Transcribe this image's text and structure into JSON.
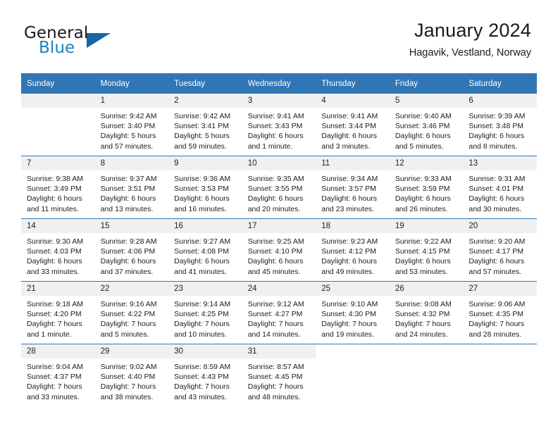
{
  "brand": {
    "word1": "General",
    "word2": "Blue",
    "accent_color": "#1a7fc1",
    "triangle_color": "#1565a8"
  },
  "header": {
    "title": "January 2024",
    "subtitle": "Hagavik, Vestland, Norway"
  },
  "calendar": {
    "header_bg": "#3076b5",
    "daynum_bg": "#f0f0f0",
    "weekday_headers": [
      "Sunday",
      "Monday",
      "Tuesday",
      "Wednesday",
      "Thursday",
      "Friday",
      "Saturday"
    ],
    "weeks": [
      [
        {
          "num": "",
          "lines": []
        },
        {
          "num": "1",
          "lines": [
            "Sunrise: 9:42 AM",
            "Sunset: 3:40 PM",
            "Daylight: 5 hours",
            "and 57 minutes."
          ]
        },
        {
          "num": "2",
          "lines": [
            "Sunrise: 9:42 AM",
            "Sunset: 3:41 PM",
            "Daylight: 5 hours",
            "and 59 minutes."
          ]
        },
        {
          "num": "3",
          "lines": [
            "Sunrise: 9:41 AM",
            "Sunset: 3:43 PM",
            "Daylight: 6 hours",
            "and 1 minute."
          ]
        },
        {
          "num": "4",
          "lines": [
            "Sunrise: 9:41 AM",
            "Sunset: 3:44 PM",
            "Daylight: 6 hours",
            "and 3 minutes."
          ]
        },
        {
          "num": "5",
          "lines": [
            "Sunrise: 9:40 AM",
            "Sunset: 3:46 PM",
            "Daylight: 6 hours",
            "and 5 minutes."
          ]
        },
        {
          "num": "6",
          "lines": [
            "Sunrise: 9:39 AM",
            "Sunset: 3:48 PM",
            "Daylight: 6 hours",
            "and 8 minutes."
          ]
        }
      ],
      [
        {
          "num": "7",
          "lines": [
            "Sunrise: 9:38 AM",
            "Sunset: 3:49 PM",
            "Daylight: 6 hours",
            "and 11 minutes."
          ]
        },
        {
          "num": "8",
          "lines": [
            "Sunrise: 9:37 AM",
            "Sunset: 3:51 PM",
            "Daylight: 6 hours",
            "and 13 minutes."
          ]
        },
        {
          "num": "9",
          "lines": [
            "Sunrise: 9:36 AM",
            "Sunset: 3:53 PM",
            "Daylight: 6 hours",
            "and 16 minutes."
          ]
        },
        {
          "num": "10",
          "lines": [
            "Sunrise: 9:35 AM",
            "Sunset: 3:55 PM",
            "Daylight: 6 hours",
            "and 20 minutes."
          ]
        },
        {
          "num": "11",
          "lines": [
            "Sunrise: 9:34 AM",
            "Sunset: 3:57 PM",
            "Daylight: 6 hours",
            "and 23 minutes."
          ]
        },
        {
          "num": "12",
          "lines": [
            "Sunrise: 9:33 AM",
            "Sunset: 3:59 PM",
            "Daylight: 6 hours",
            "and 26 minutes."
          ]
        },
        {
          "num": "13",
          "lines": [
            "Sunrise: 9:31 AM",
            "Sunset: 4:01 PM",
            "Daylight: 6 hours",
            "and 30 minutes."
          ]
        }
      ],
      [
        {
          "num": "14",
          "lines": [
            "Sunrise: 9:30 AM",
            "Sunset: 4:03 PM",
            "Daylight: 6 hours",
            "and 33 minutes."
          ]
        },
        {
          "num": "15",
          "lines": [
            "Sunrise: 9:28 AM",
            "Sunset: 4:06 PM",
            "Daylight: 6 hours",
            "and 37 minutes."
          ]
        },
        {
          "num": "16",
          "lines": [
            "Sunrise: 9:27 AM",
            "Sunset: 4:08 PM",
            "Daylight: 6 hours",
            "and 41 minutes."
          ]
        },
        {
          "num": "17",
          "lines": [
            "Sunrise: 9:25 AM",
            "Sunset: 4:10 PM",
            "Daylight: 6 hours",
            "and 45 minutes."
          ]
        },
        {
          "num": "18",
          "lines": [
            "Sunrise: 9:23 AM",
            "Sunset: 4:12 PM",
            "Daylight: 6 hours",
            "and 49 minutes."
          ]
        },
        {
          "num": "19",
          "lines": [
            "Sunrise: 9:22 AM",
            "Sunset: 4:15 PM",
            "Daylight: 6 hours",
            "and 53 minutes."
          ]
        },
        {
          "num": "20",
          "lines": [
            "Sunrise: 9:20 AM",
            "Sunset: 4:17 PM",
            "Daylight: 6 hours",
            "and 57 minutes."
          ]
        }
      ],
      [
        {
          "num": "21",
          "lines": [
            "Sunrise: 9:18 AM",
            "Sunset: 4:20 PM",
            "Daylight: 7 hours",
            "and 1 minute."
          ]
        },
        {
          "num": "22",
          "lines": [
            "Sunrise: 9:16 AM",
            "Sunset: 4:22 PM",
            "Daylight: 7 hours",
            "and 5 minutes."
          ]
        },
        {
          "num": "23",
          "lines": [
            "Sunrise: 9:14 AM",
            "Sunset: 4:25 PM",
            "Daylight: 7 hours",
            "and 10 minutes."
          ]
        },
        {
          "num": "24",
          "lines": [
            "Sunrise: 9:12 AM",
            "Sunset: 4:27 PM",
            "Daylight: 7 hours",
            "and 14 minutes."
          ]
        },
        {
          "num": "25",
          "lines": [
            "Sunrise: 9:10 AM",
            "Sunset: 4:30 PM",
            "Daylight: 7 hours",
            "and 19 minutes."
          ]
        },
        {
          "num": "26",
          "lines": [
            "Sunrise: 9:08 AM",
            "Sunset: 4:32 PM",
            "Daylight: 7 hours",
            "and 24 minutes."
          ]
        },
        {
          "num": "27",
          "lines": [
            "Sunrise: 9:06 AM",
            "Sunset: 4:35 PM",
            "Daylight: 7 hours",
            "and 28 minutes."
          ]
        }
      ],
      [
        {
          "num": "28",
          "lines": [
            "Sunrise: 9:04 AM",
            "Sunset: 4:37 PM",
            "Daylight: 7 hours",
            "and 33 minutes."
          ]
        },
        {
          "num": "29",
          "lines": [
            "Sunrise: 9:02 AM",
            "Sunset: 4:40 PM",
            "Daylight: 7 hours",
            "and 38 minutes."
          ]
        },
        {
          "num": "30",
          "lines": [
            "Sunrise: 8:59 AM",
            "Sunset: 4:43 PM",
            "Daylight: 7 hours",
            "and 43 minutes."
          ]
        },
        {
          "num": "31",
          "lines": [
            "Sunrise: 8:57 AM",
            "Sunset: 4:45 PM",
            "Daylight: 7 hours",
            "and 48 minutes."
          ]
        },
        {
          "num": "",
          "lines": []
        },
        {
          "num": "",
          "lines": []
        },
        {
          "num": "",
          "lines": []
        }
      ]
    ]
  }
}
